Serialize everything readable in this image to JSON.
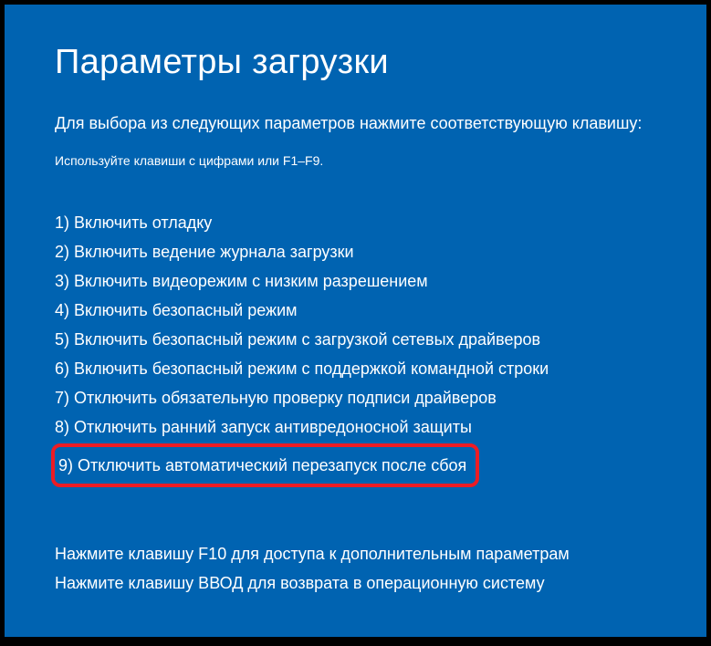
{
  "title": "Параметры загрузки",
  "instruction": "Для выбора из следующих параметров нажмите соответствующую клавишу:",
  "hint": "Используйте клавиши с цифрами или F1–F9.",
  "options": [
    "1) Включить отладку",
    "2) Включить ведение журнала загрузки",
    "3) Включить видеорежим с низким разрешением",
    "4) Включить безопасный режим",
    "5) Включить безопасный режим с загрузкой сетевых драйверов",
    "6) Включить безопасный режим с поддержкой командной строки",
    "7) Отключить обязательную проверку подписи драйверов",
    "8) Отключить ранний запуск антивредоносной защиты",
    "9) Отключить автоматический перезапуск после сбоя"
  ],
  "footer_f10": "Нажмите клавишу F10 для доступа к дополнительным параметрам",
  "footer_enter": "Нажмите клавишу ВВОД для возврата в операционную систему"
}
